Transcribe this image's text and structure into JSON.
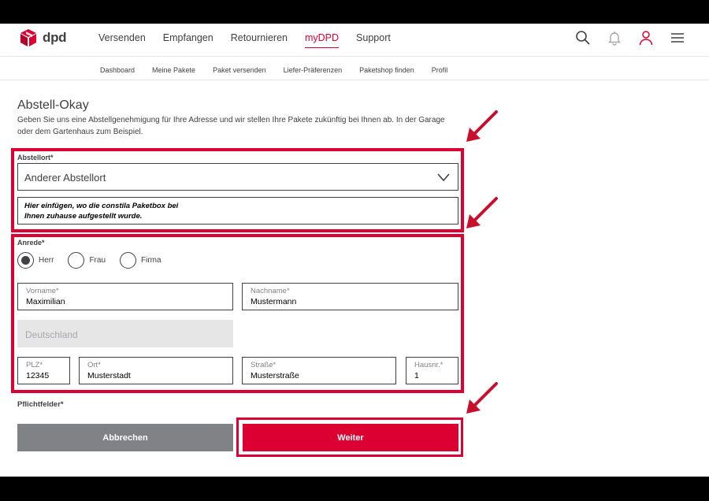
{
  "brand": {
    "name": "dpd",
    "accent": "#dc0032"
  },
  "main_nav": [
    {
      "label": "Versenden",
      "active": false
    },
    {
      "label": "Empfangen",
      "active": false
    },
    {
      "label": "Retournieren",
      "active": false
    },
    {
      "label": "myDPD",
      "active": true
    },
    {
      "label": "Support",
      "active": false
    }
  ],
  "header_icons": [
    "search-icon",
    "bell-icon",
    "user-icon",
    "menu-icon"
  ],
  "sub_nav": [
    "Dashboard",
    "Meine Pakete",
    "Paket versenden",
    "Liefer-Präferenzen",
    "Paketshop finden",
    "Profil"
  ],
  "section": {
    "title": "Abstell-Okay",
    "description": "Geben Sie uns eine Abstellgenehmigung für Ihre Adresse und wir stellen Ihre Pakete zukünftig bei Ihnen ab. In der Garage oder dem Gartenhaus zum Beispiel."
  },
  "abstellort": {
    "label": "Abstellort*",
    "selected": "Anderer Abstellort",
    "note": "Hier einfügen, wo die constila Paketbox bei\nIhnen zuhause aufgestellt wurde."
  },
  "anrede": {
    "label": "Anrede*",
    "options": [
      {
        "label": "Herr",
        "selected": true
      },
      {
        "label": "Frau",
        "selected": false
      },
      {
        "label": "Firma",
        "selected": false
      }
    ]
  },
  "fields": {
    "vorname": {
      "label": "Vorname*",
      "value": "Maximilian"
    },
    "nachname": {
      "label": "Nachname*",
      "value": "Mustermann"
    },
    "land": {
      "placeholder": "Deutschland"
    },
    "plz": {
      "label": "PLZ*",
      "value": "12345"
    },
    "ort": {
      "label": "Ort*",
      "value": "Musterstadt"
    },
    "strasse": {
      "label": "Straße*",
      "value": "Musterstraße"
    },
    "hausnr": {
      "label": "Hausnr.*",
      "value": "1"
    }
  },
  "required_note": "Pflichtfelder*",
  "buttons": {
    "cancel": "Abbrechen",
    "next": "Weiter"
  }
}
